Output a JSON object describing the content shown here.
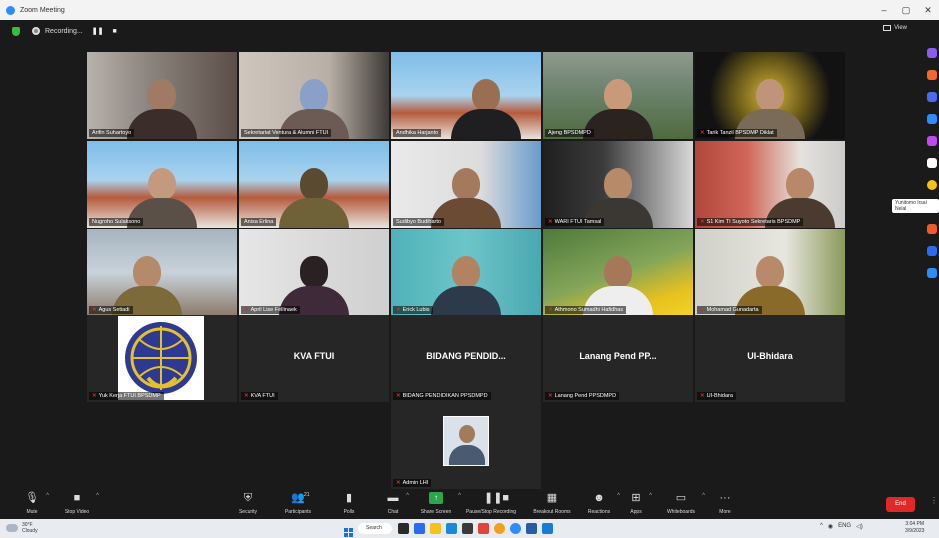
{
  "window": {
    "title": "Zoom Meeting",
    "controls": [
      "–",
      "▢",
      "✕"
    ]
  },
  "topbar": {
    "recording_label": "Recording...",
    "pause_label": "❚❚",
    "stop_label": "■",
    "view_label": "View"
  },
  "participants": [
    {
      "name": "Arifin Suhartoyo"
    },
    {
      "name": "Sekretariat Ventura & Alumni FTUI"
    },
    {
      "name": "Andhika Harjanto"
    },
    {
      "name": "Ajeng BPSDMPD"
    },
    {
      "name": "Tarik Tanzil BPSDMP Diklat"
    },
    {
      "name": "Nugroho Sulaksono"
    },
    {
      "name": "Anisa Erlina"
    },
    {
      "name": "Sudibyo Budiharto"
    },
    {
      "name": "WARI FTUI Tamsal"
    },
    {
      "name": "S1 Kim TI Suyoto Sekretaris BPSDMP"
    },
    {
      "name": "Agus Setiadi"
    },
    {
      "name": "April Lise Fellinaek"
    },
    {
      "name": "Erick Lubis"
    },
    {
      "name": "Athmono Sumadhi Hafidhas"
    },
    {
      "name": "Mohamad Gunadarta"
    },
    {
      "name": "Yuk Kerja FTUI BPSDMP"
    },
    {
      "name": "KVA FTUI",
      "display": "KVA FTUI"
    },
    {
      "name": "BIDANG PENDIDIKAN PPSDMPD",
      "display": "BIDANG PENDID..."
    },
    {
      "name": "Lanang Pend PPSDMPD",
      "display": "Lanang Pend PP..."
    },
    {
      "name": "UI-Bhidara",
      "display": "UI-Bhidara"
    },
    {
      "name": "Admin LHI"
    }
  ],
  "tooltip": "Yunitomo Irsal Nelal",
  "toolbar": {
    "mute": "Mute",
    "stop_video": "Stop Video",
    "security": "Security",
    "participants": "Participants",
    "participants_count": "21",
    "polls": "Polls",
    "chat": "Chat",
    "share": "Share Screen",
    "record": "Pause/Stop Recording",
    "breakout": "Breakout Rooms",
    "reactions": "Reactions",
    "apps": "Apps",
    "whiteboards": "Whiteboards",
    "more": "More",
    "end": "End"
  },
  "taskbar": {
    "weather_temp": "30°F",
    "weather_desc": "Cloudy",
    "search": "Search",
    "tray_language": "ENG",
    "time": "3:04 PM",
    "date": "3/9/2023"
  },
  "colors": {
    "active_speaker": "#c9d34a",
    "end_button": "#e02828",
    "share_button": "#2ca64a"
  }
}
